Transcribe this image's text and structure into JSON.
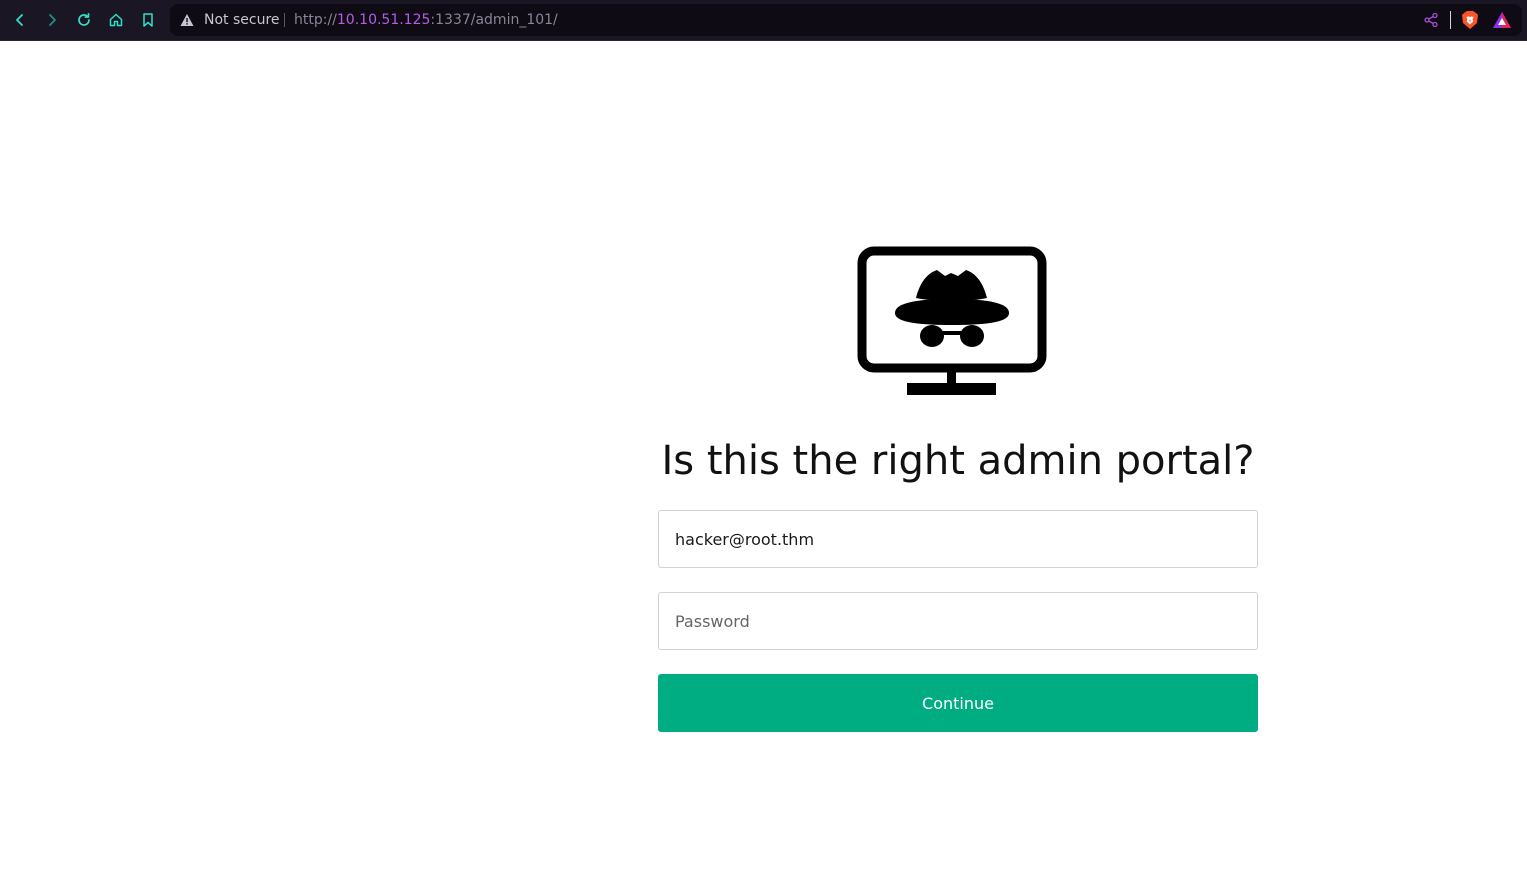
{
  "browser": {
    "security_label": "Not secure",
    "url_scheme": "http://",
    "url_host": "10.10.51.125",
    "url_path": ":1337/admin_101/",
    "accent_color": "#2fe0c8",
    "icons": [
      "back-icon",
      "forward-icon",
      "reload-icon",
      "home-icon",
      "bookmark-icon",
      "warning-icon",
      "share-icon",
      "brave-shields-icon",
      "brave-rewards-icon"
    ]
  },
  "page": {
    "logo_icon": "incognito-monitor-icon",
    "heading": "Is this the right admin portal?",
    "email_value": "hacker@root.thm",
    "password_placeholder": "Password",
    "continue_label": "Continue",
    "button_color": "#00ad82"
  }
}
